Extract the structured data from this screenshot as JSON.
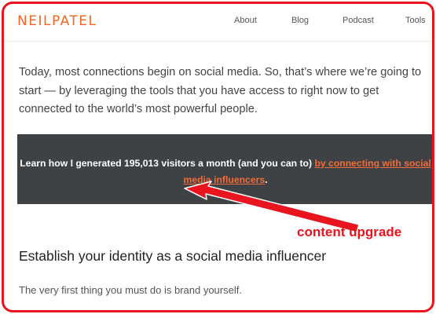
{
  "header": {
    "logo": "NEILPATEL",
    "nav": [
      {
        "label": "About"
      },
      {
        "label": "Blog"
      },
      {
        "label": "Podcast"
      },
      {
        "label": "Tools"
      }
    ]
  },
  "article": {
    "intro": "Today, most connections begin on social media. So, that’s where we’re going to start — by leveraging the tools that you have access to right now to get connected to the world’s most powerful people.",
    "cta": {
      "text_before": "Learn how I generated 195,013 visitors a month (and you can to) ",
      "link_text": "by connecting with social media influencers",
      "text_after": "."
    },
    "heading": "Establish your identity as a social media influencer",
    "paragraph": "The very first thing you must do is brand yourself."
  },
  "annotation": {
    "label": "content upgrade",
    "color": "#e8141e"
  },
  "colors": {
    "brand": "#f26522",
    "cta_background": "#3f4244",
    "link": "#f26b3a"
  }
}
